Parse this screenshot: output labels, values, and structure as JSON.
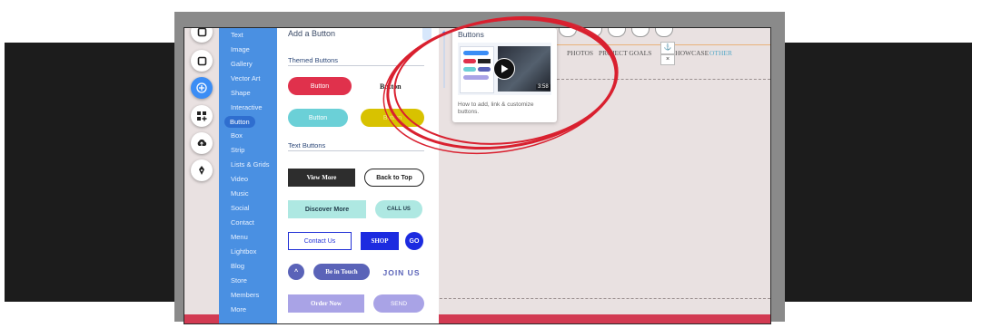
{
  "categories": [
    "Text",
    "Image",
    "Gallery",
    "Vector Art",
    "Shape",
    "Interactive",
    "Button",
    "Box",
    "Strip",
    "Lists & Grids",
    "Video",
    "Music",
    "Social",
    "Contact",
    "Menu",
    "Lightbox",
    "Blog",
    "Store",
    "Members",
    "More"
  ],
  "selected_category": "Button",
  "panel": {
    "header": "Add a Button",
    "themed_title": "Themed Buttons",
    "text_title": "Text Buttons",
    "themed": [
      "Button",
      "Button",
      "Button",
      "Button"
    ],
    "text_buttons": {
      "view_more": "View More",
      "back_to_top": "Back to Top",
      "discover_more": "Discover More",
      "call_us": "CALL US",
      "contact_us": "Contact Us",
      "shop": "SHOP",
      "go": "GO",
      "up_arrow": "^",
      "be_in_touch": "Be in Touch",
      "join_us": "JOIN US",
      "order_now": "Order Now",
      "send": "SEND"
    }
  },
  "video_card": {
    "title": "Buttons",
    "duration": "3:58",
    "description": "How to add, link & customize buttons."
  },
  "site_nav": [
    "PHOTOS",
    "PROJECT GOALS",
    "SHOWCASE",
    "OTHER"
  ],
  "colors": {
    "accent": "#3b8df5",
    "category_panel": "#4a90e2",
    "annotation_circle": "#d9202f",
    "site_bottom_bar": "#d23a52"
  },
  "icons": [
    "layout-icon",
    "plus-icon",
    "apps-icon",
    "upload-icon",
    "pen-icon",
    "play-icon",
    "anchor-icon",
    "close-icon"
  ]
}
